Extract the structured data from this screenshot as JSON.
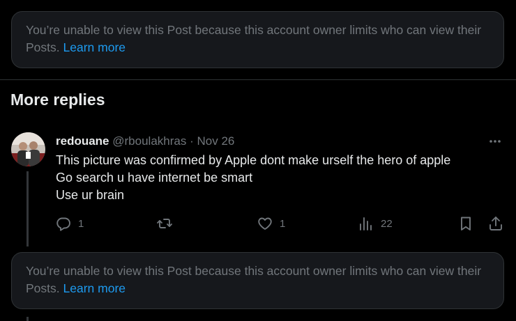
{
  "notices": {
    "top": {
      "text": "You’re unable to view this Post because this account owner limits who can view their Posts.",
      "link": "Learn more"
    },
    "bottom": {
      "text": "You’re unable to view this Post because this account owner limits who can view their Posts.",
      "link": "Learn more"
    }
  },
  "section": {
    "heading": "More replies"
  },
  "reply": {
    "author_name": "redouane",
    "author_handle": "@rboulakhras",
    "separator": "·",
    "date": "Nov 26",
    "lines": [
      "This picture was confirmed by Apple dont make urself the hero of apple",
      "Go search u have internet be smart",
      "Use ur brain"
    ],
    "actions": {
      "reply_count": "1",
      "like_count": "1",
      "views_count": "22"
    }
  },
  "colors": {
    "background": "#000000",
    "card": "#16181c",
    "border": "#2f3336",
    "text_primary": "#e7e9ea",
    "text_secondary": "#71767b",
    "link": "#1d9bf0"
  },
  "icons": [
    "reply-icon",
    "retweet-icon",
    "like-icon",
    "views-icon",
    "bookmark-icon",
    "share-icon",
    "more-icon"
  ]
}
